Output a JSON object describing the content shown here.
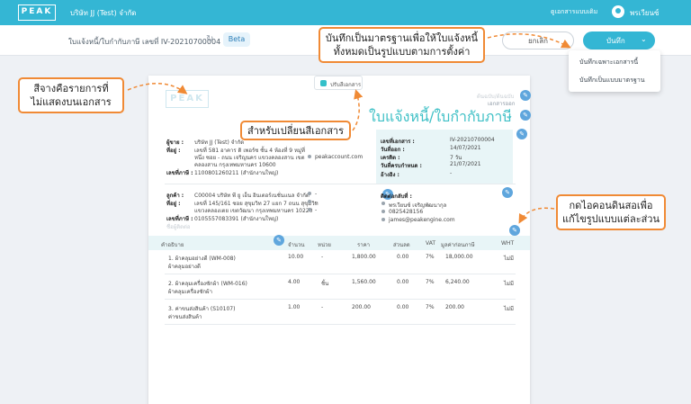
{
  "app": {
    "logo": "PEAK",
    "company": "บริษัท JJ (Test) จำกัด",
    "doc_link": "ดูเอกสารแบบเดิม",
    "username": "พรเวียนซ์"
  },
  "header": {
    "doc_title": "ใบแจ้งหนี้/ใบกำกับภาษี เลขที่ IV-20210700004",
    "refresh_icon": "↻",
    "beta": "Beta",
    "cancel": "ยกเลิก",
    "save": "บันทึก",
    "save_chevron": "⌄"
  },
  "save_menu": {
    "items": [
      "บันทึกเฉพาะเอกสารนี้",
      "บันทึกเป็นแบบมาตรฐาน"
    ]
  },
  "document": {
    "logo_ghost": "PEAK",
    "color_picker": "ปรับสีเอกสาร",
    "color_swatch": "#34c0c9",
    "title": "ใบแจ้งหนี้/ใบกำกับภาษี",
    "original": "ต้นฉบับ/ต้นฉบับ",
    "original_sub": "เอกสารออก",
    "seller": {
      "label_seller": "ผู้ขาย :",
      "name": "บริษัท JJ (Test) จำกัด",
      "label_address": "ที่อยู่ :",
      "address1": "เลขที่ 581 อาคาร ดิ เพอร์ซ ชั้น 4 ห้องที่ 9 หมู่ที่",
      "address2": "หนึ่ง ซอย - ถนน เจริญนคร แขวงคลองสาน เขต",
      "address3": "คลองสาน กรุงเทพมหานคร 10600",
      "label_tax": "เลขที่ภาษี :",
      "tax": "1100801260211 (สำนักงานใหญ่)",
      "email": "peakaccount.com"
    },
    "info": {
      "label_no": "เลขที่เอกสาร :",
      "no": "IV-20210700004",
      "label_date": "วันที่ออก :",
      "date": "14/07/2021",
      "label_credit": "เครดิต :",
      "credit": "7 วัน",
      "label_due": "วันที่ครบกำหนด :",
      "due": "21/07/2021",
      "label_ref": "อ้างอิง :",
      "ref": "-"
    },
    "customer": {
      "label_customer": "ลูกค้า :",
      "name": "C00004 บริษัท พี ยู เอ็น อินเตอร์เนชั่นแนล จำกัด",
      "label_address": "ที่อยู่ :",
      "address1": "เลขที่ 145/161 ซอย สุขุมวิท 27 แยก 7 ถนน สุขุมวิท",
      "address2": "แขวงคลองเตย เขตวัฒนา กรุงเทพมหานคร 10220",
      "label_tax": "เลขที่ภาษี :",
      "tax": "0105557083391 (สำนักงานใหญ่)",
      "branch": "ชื่อผู้ติดต่อ",
      "phone": "-",
      "fax": "-",
      "email": "-"
    },
    "contact": {
      "label": "ติดต่อกลับที่ :",
      "name": "พรเวียนซ์ เจริญพัฒนากุล",
      "phone": "0825428156",
      "email": "james@peakengine.com"
    },
    "table": {
      "headers": [
        "คำอธิบาย",
        "จำนวน",
        "หน่วย",
        "ราคา",
        "ส่วนลด",
        "VAT",
        "มูลค่าก่อนภาษี",
        "WHT"
      ],
      "rows": [
        {
          "title": "1. ผ้าคลุมอย่างดี (WM-008)",
          "sub": "ผ้าคลุมอย่างดี",
          "qty": "10.00",
          "unit": "-",
          "price": "1,800.00",
          "disc": "0.00",
          "vat": "7%",
          "amount": "18,000.00",
          "wht": "ไม่มี"
        },
        {
          "title": "2. ผ้าคลุมเครื่องซักผ้า (WM-016)",
          "sub": "ผ้าคลุมเครื่องซักผ้า",
          "qty": "4.00",
          "unit": "ชิ้น",
          "price": "1,560.00",
          "disc": "0.00",
          "vat": "7%",
          "amount": "6,240.00",
          "wht": "ไม่มี"
        },
        {
          "title": "3. ค่าขนส่งสินค้า (S10107)",
          "sub": "ค่าขนส่งสินค้า",
          "qty": "1.00",
          "unit": "-",
          "price": "200.00",
          "disc": "0.00",
          "vat": "7%",
          "amount": "200.00",
          "wht": "ไม่มี"
        }
      ]
    }
  },
  "callouts": {
    "save_standard": [
      "บันทึกเป็นมาตรฐานเพื่อให้ใบแจ้งหนี้",
      "ทั้งหมดเป็นรูปแบบตามการตั้งค่า"
    ],
    "grey_items": [
      "สีจางคือรายการที่",
      "ไม่แสดงบนเอกสาร"
    ],
    "change_color": "สำหรับเปลี่ยนสีเอกสาร",
    "pencil_edit": [
      "กดไอคอนดินสอเพื่อ",
      "แก้ไขรูปแบบแต่ละส่วน"
    ]
  },
  "colors": {
    "brand": "#34b6d4",
    "callout_border": "#f08a35",
    "title": "#3ec0c6",
    "pencil": "#5fa6dd",
    "pencil_alt": "#6cc06c"
  }
}
